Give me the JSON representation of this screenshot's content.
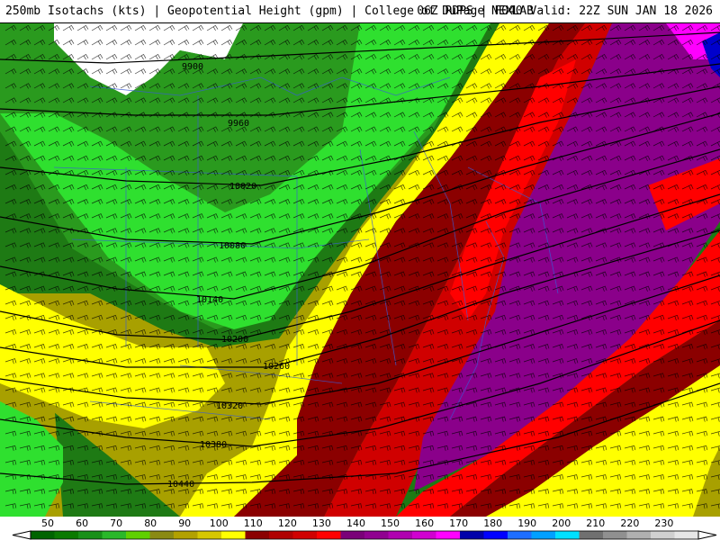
{
  "header": {
    "title_left": "250mb Isotachs (kts) | Geopotential Height (gpm) | College of DuPage NEXLAB",
    "title_right": "06Z RDPS | F040 Valid: 22Z SUN JAN 18 2026"
  },
  "contour_labels": [
    "9900",
    "9960",
    "10020",
    "10080",
    "10140",
    "10200",
    "10260",
    "10320",
    "10380",
    "10440"
  ],
  "legend": {
    "labels": [
      "50",
      "60",
      "70",
      "80",
      "90",
      "100",
      "110",
      "120",
      "130",
      "140",
      "150",
      "160",
      "170",
      "180",
      "190",
      "200",
      "210",
      "220",
      "230"
    ],
    "colors": [
      "#006400",
      "#0a7a00",
      "#189018",
      "#2ab82a",
      "#5fd000",
      "#8a8a14",
      "#b2a100",
      "#d6c700",
      "#ffff00",
      "#8b0000",
      "#b00000",
      "#d00000",
      "#ff0000",
      "#7a0078",
      "#900090",
      "#b000b0",
      "#d000d0",
      "#ff00ff",
      "#0000aa",
      "#0000ff",
      "#1e6eff",
      "#00a0ff",
      "#00e0ff",
      "#707070",
      "#909090",
      "#b0b0b0",
      "#d0d0d0",
      "#e6e6e6"
    ]
  },
  "colors": {
    "green_dark": "#1e7a14",
    "green_mid": "#2a9a1e",
    "green_light": "#5fd000",
    "green_bright": "#2fe02f",
    "olive": "#a8a000",
    "yellow": "#ffff00",
    "maroon": "#8b0000",
    "dark_red": "#b00000",
    "red": "#ff0000",
    "purple": "#8a008a",
    "magenta": "#ff00ff",
    "blue": "#0000cc"
  }
}
